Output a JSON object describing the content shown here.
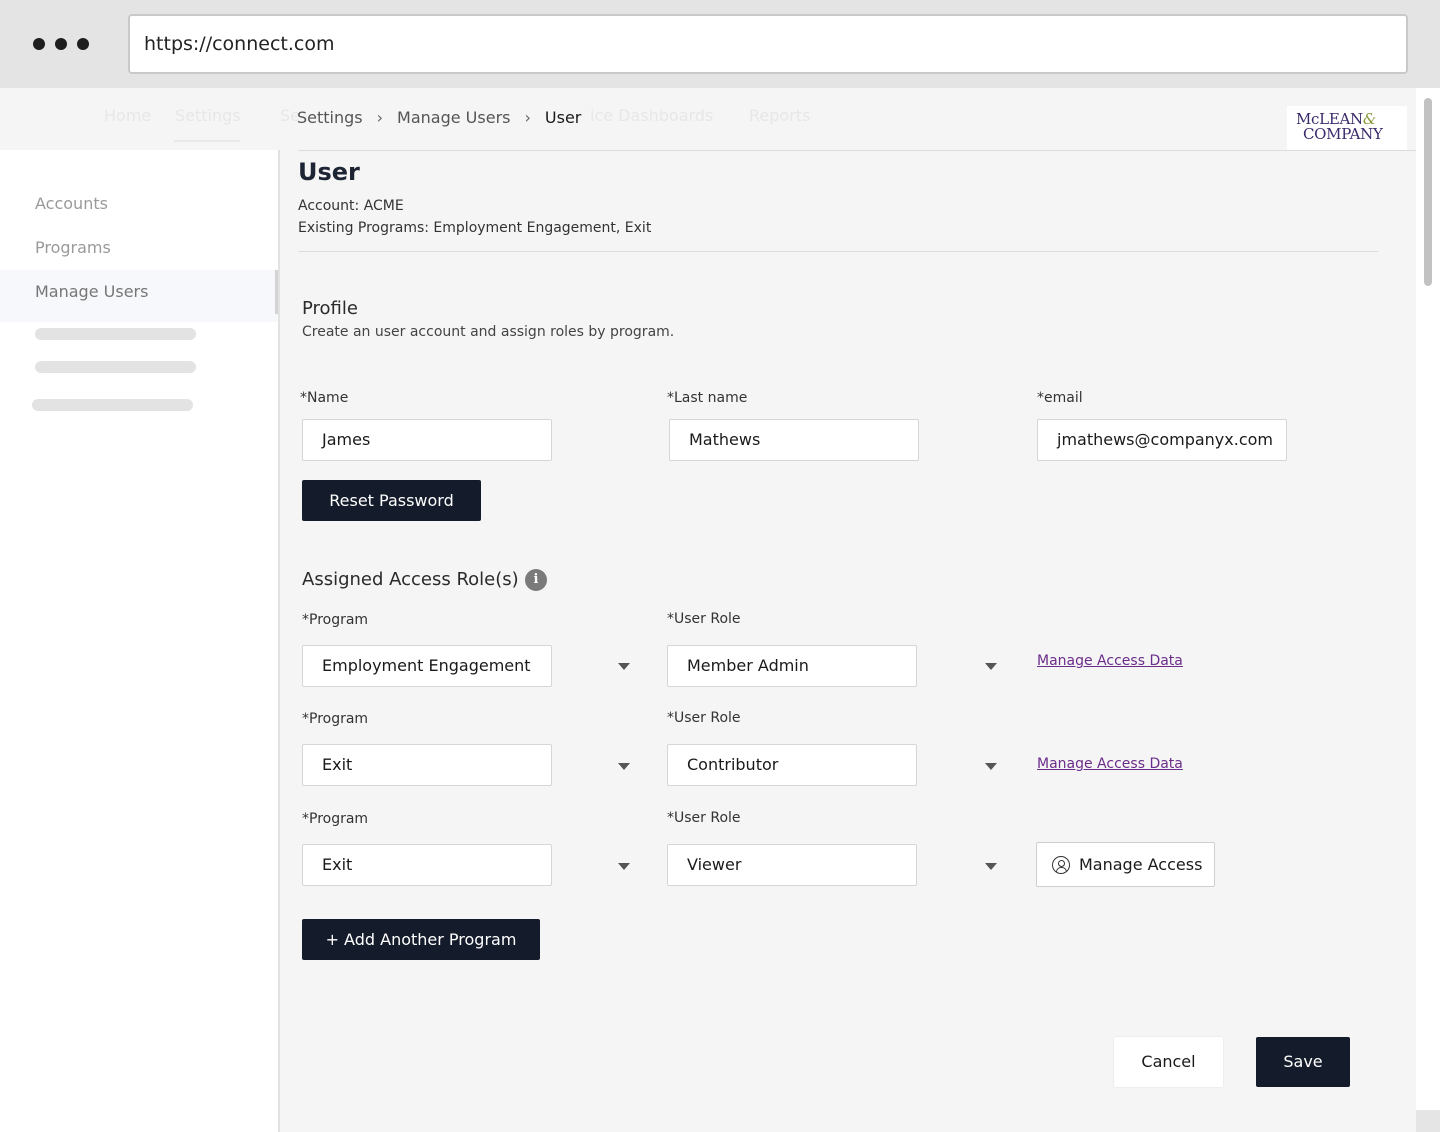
{
  "browser": {
    "url": "https://connect.com"
  },
  "topnav": {
    "items": [
      "Home",
      "Settings",
      "Se",
      "ice Dashboards",
      "Reports"
    ]
  },
  "breadcrumb": {
    "items": [
      "Settings",
      "Manage Users",
      "User"
    ],
    "separator": ">"
  },
  "logo": {
    "line1": "McLEAN",
    "amp": "&",
    "line2": "COMPANY"
  },
  "sidebar": {
    "items": [
      {
        "label": "Accounts"
      },
      {
        "label": "Programs"
      },
      {
        "label": "Manage Users",
        "active": true
      }
    ]
  },
  "header": {
    "title": "User",
    "account": "Account: ACME",
    "existing_programs": "Existing Programs:  Employment Engagement, Exit"
  },
  "profile": {
    "title": "Profile",
    "description": "Create an user account and assign roles by program.",
    "fields": {
      "name": {
        "label": "*Name",
        "value": "James"
      },
      "last_name": {
        "label": "*Last name",
        "value": "Mathews"
      },
      "email": {
        "label": "*email",
        "value": "jmathews@companyx.com"
      }
    },
    "reset_password_label": "Reset Password"
  },
  "roles": {
    "title": "Assigned Access Role(s)",
    "info_icon": "i",
    "rows": [
      {
        "program_label": "*Program",
        "program": "Employment Engagement",
        "role_label": "*User Role",
        "role": "Member Admin",
        "action": "Manage Access Data"
      },
      {
        "program_label": "*Program",
        "program": "Exit",
        "role_label": "*User Role",
        "role": "Contributor",
        "action": "Manage Access Data"
      },
      {
        "program_label": "*Program",
        "program": "Exit",
        "role_label": "*User Role",
        "role": "Viewer",
        "action": "Manage Access"
      }
    ],
    "add_program_label": "+ Add Another Program"
  },
  "footer": {
    "cancel_label": "Cancel",
    "save_label": "Save"
  },
  "colors": {
    "primary_button": "#141b2b",
    "link": "#6b2d8a",
    "page_bg": "#f5f5f5"
  }
}
